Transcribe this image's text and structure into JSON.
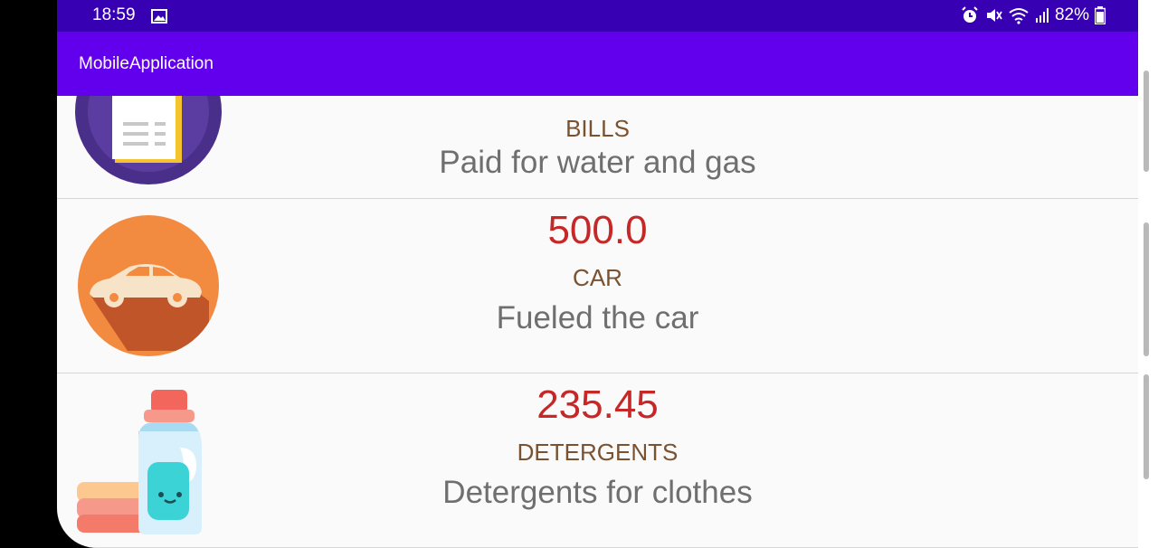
{
  "status_bar": {
    "time": "18:59",
    "battery": "82%",
    "icons": [
      "gallery-icon",
      "alarm-icon",
      "mute-icon",
      "wifi-icon",
      "signal-icon",
      "battery-icon"
    ]
  },
  "app_bar": {
    "title": "MobileApplication",
    "color": "#6200ee",
    "status_color": "#3700b3"
  },
  "transactions": [
    {
      "amount": "",
      "category": "BILLS",
      "description": "Paid for water and gas",
      "icon": "bills-icon"
    },
    {
      "amount": "500.0",
      "category": "CAR",
      "description": "Fueled the car",
      "icon": "car-icon"
    },
    {
      "amount": "235.45",
      "category": "DETERGENTS",
      "description": "Detergents for clothes",
      "icon": "detergent-icon"
    }
  ],
  "colors": {
    "amount": "#c62828",
    "category": "#7a5230",
    "description": "#6f6f6f"
  }
}
